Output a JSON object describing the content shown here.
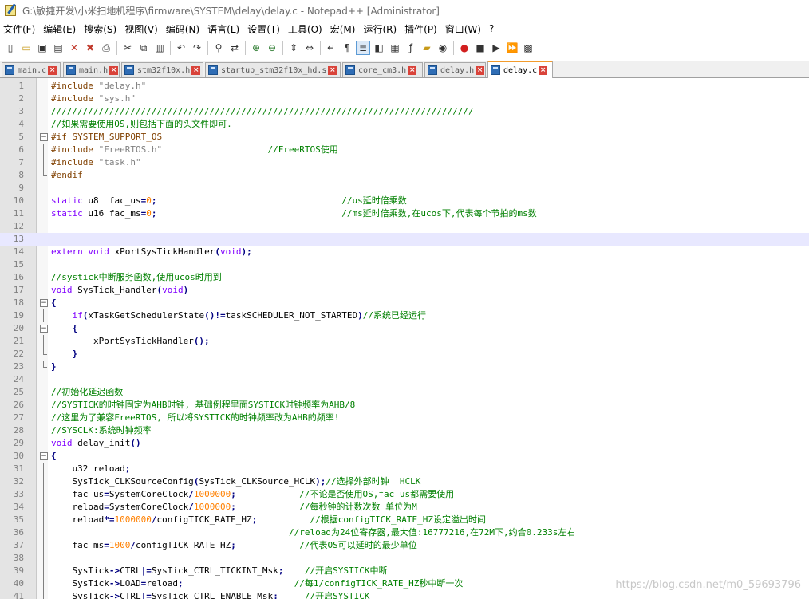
{
  "window": {
    "title": "G:\\敏捷开发\\小米扫地机程序\\firmware\\SYSTEM\\delay\\delay.c - Notepad++ [Administrator]"
  },
  "menu": [
    "文件(F)",
    "编辑(E)",
    "搜索(S)",
    "视图(V)",
    "编码(N)",
    "语言(L)",
    "设置(T)",
    "工具(O)",
    "宏(M)",
    "运行(R)",
    "插件(P)",
    "窗口(W)",
    "?"
  ],
  "toolbar_icons": [
    "new-file-icon",
    "open-file-icon",
    "save-icon",
    "save-all-icon",
    "close-icon",
    "close-all-icon",
    "print-icon",
    "cut-icon",
    "copy-icon",
    "paste-icon",
    "undo-icon",
    "redo-icon",
    "find-icon",
    "replace-icon",
    "zoom-in-icon",
    "zoom-out-icon",
    "sync-vertical-icon",
    "sync-horizontal-icon",
    "word-wrap-icon",
    "show-all-chars-icon",
    "indent-guide-icon",
    "user-lang-icon",
    "doc-map-icon",
    "function-list-icon",
    "folder-workspace-icon",
    "monitor-icon",
    "record-macro-icon",
    "stop-record-icon",
    "play-macro-icon",
    "run-macro-multiple-icon",
    "save-macro-icon"
  ],
  "tabs": [
    {
      "label": "main.c",
      "active": false
    },
    {
      "label": "main.h",
      "active": false
    },
    {
      "label": "stm32f10x.h",
      "active": false
    },
    {
      "label": "startup_stm32f10x_hd.s",
      "active": false
    },
    {
      "label": "core_cm3.h",
      "active": false
    },
    {
      "label": "delay.h",
      "active": false
    },
    {
      "label": "delay.c",
      "active": true
    }
  ],
  "editor": {
    "current_line": 13,
    "lines": [
      {
        "n": 1,
        "tokens": [
          [
            "pp",
            "#include "
          ],
          [
            "str",
            "\"delay.h\""
          ]
        ]
      },
      {
        "n": 2,
        "tokens": [
          [
            "pp",
            "#include "
          ],
          [
            "str",
            "\"sys.h\""
          ]
        ]
      },
      {
        "n": 3,
        "tokens": [
          [
            "cm",
            "////////////////////////////////////////////////////////////////////////////////"
          ]
        ]
      },
      {
        "n": 4,
        "tokens": [
          [
            "cm",
            "//如果需要使用OS,则包括下面的头文件即可."
          ]
        ]
      },
      {
        "n": 5,
        "fold": "open",
        "tokens": [
          [
            "pp",
            "#if SYSTEM_SUPPORT_OS"
          ]
        ]
      },
      {
        "n": 6,
        "fold": "bar",
        "tokens": [
          [
            "pp",
            "#include "
          ],
          [
            "str",
            "\"FreeRTOS.h\""
          ],
          [
            "id",
            "                    "
          ],
          [
            "cm",
            "//FreeRTOS使用"
          ]
        ]
      },
      {
        "n": 7,
        "fold": "bar",
        "tokens": [
          [
            "pp",
            "#include "
          ],
          [
            "str",
            "\"task.h\""
          ]
        ]
      },
      {
        "n": 8,
        "fold": "end",
        "tokens": [
          [
            "pp",
            "#endif"
          ]
        ]
      },
      {
        "n": 9,
        "tokens": []
      },
      {
        "n": 10,
        "tokens": [
          [
            "kw",
            "static"
          ],
          [
            "id",
            " u8  fac_us"
          ],
          [
            "op",
            "="
          ],
          [
            "num",
            "0"
          ],
          [
            "op",
            ";"
          ],
          [
            "id",
            "                                   "
          ],
          [
            "cm",
            "//us延时倍乘数"
          ]
        ]
      },
      {
        "n": 11,
        "tokens": [
          [
            "kw",
            "static"
          ],
          [
            "id",
            " u16 fac_ms"
          ],
          [
            "op",
            "="
          ],
          [
            "num",
            "0"
          ],
          [
            "op",
            ";"
          ],
          [
            "id",
            "                                   "
          ],
          [
            "cm",
            "//ms延时倍乘数,在ucos下,代表每个节拍的ms数"
          ]
        ]
      },
      {
        "n": 12,
        "tokens": []
      },
      {
        "n": 13,
        "tokens": []
      },
      {
        "n": 14,
        "tokens": [
          [
            "kw",
            "extern"
          ],
          [
            "id",
            " "
          ],
          [
            "kw",
            "void"
          ],
          [
            "id",
            " xPortSysTickHandler"
          ],
          [
            "op",
            "("
          ],
          [
            "kw",
            "void"
          ],
          [
            "op",
            ");"
          ]
        ]
      },
      {
        "n": 15,
        "tokens": []
      },
      {
        "n": 16,
        "tokens": [
          [
            "cm",
            "//systick中断服务函数,使用ucos时用到"
          ]
        ]
      },
      {
        "n": 17,
        "tokens": [
          [
            "kw",
            "void"
          ],
          [
            "id",
            " SysTick_Handler"
          ],
          [
            "op",
            "("
          ],
          [
            "kw",
            "void"
          ],
          [
            "op",
            ")"
          ]
        ]
      },
      {
        "n": 18,
        "fold": "open",
        "tokens": [
          [
            "op",
            "{"
          ]
        ]
      },
      {
        "n": 19,
        "fold": "bar",
        "tokens": [
          [
            "id",
            "    "
          ],
          [
            "kw",
            "if"
          ],
          [
            "op",
            "("
          ],
          [
            "id",
            "xTaskGetSchedulerState"
          ],
          [
            "op",
            "()!="
          ],
          [
            "id",
            "taskSCHEDULER_NOT_STARTED"
          ],
          [
            "op",
            ")"
          ],
          [
            "cm",
            "//系统已经运行"
          ]
        ]
      },
      {
        "n": 20,
        "fold": "open",
        "tokens": [
          [
            "id",
            "    "
          ],
          [
            "op",
            "{"
          ]
        ]
      },
      {
        "n": 21,
        "fold": "bar",
        "tokens": [
          [
            "id",
            "        xPortSysTickHandler"
          ],
          [
            "op",
            "();"
          ]
        ]
      },
      {
        "n": 22,
        "fold": "end",
        "tokens": [
          [
            "id",
            "    "
          ],
          [
            "op",
            "}"
          ]
        ]
      },
      {
        "n": 23,
        "fold": "end",
        "tokens": [
          [
            "op",
            "}"
          ]
        ]
      },
      {
        "n": 24,
        "tokens": []
      },
      {
        "n": 25,
        "tokens": [
          [
            "cm",
            "//初始化延迟函数"
          ]
        ]
      },
      {
        "n": 26,
        "tokens": [
          [
            "cm",
            "//SYSTICK的时钟固定为AHB时钟, 基础例程里面SYSTICK时钟频率为AHB/8"
          ]
        ]
      },
      {
        "n": 27,
        "tokens": [
          [
            "cm",
            "//这里为了兼容FreeRTOS, 所以将SYSTICK的时钟频率改为AHB的频率!"
          ]
        ]
      },
      {
        "n": 28,
        "tokens": [
          [
            "cm",
            "//SYSCLK:系统时钟频率"
          ]
        ]
      },
      {
        "n": 29,
        "tokens": [
          [
            "kw",
            "void"
          ],
          [
            "id",
            " delay_init"
          ],
          [
            "op",
            "()"
          ]
        ]
      },
      {
        "n": 30,
        "fold": "open",
        "tokens": [
          [
            "op",
            "{"
          ]
        ]
      },
      {
        "n": 31,
        "fold": "bar",
        "tokens": [
          [
            "id",
            "    u32 reload"
          ],
          [
            "op",
            ";"
          ]
        ]
      },
      {
        "n": 32,
        "fold": "bar",
        "tokens": [
          [
            "id",
            "    SysTick_CLKSourceConfig"
          ],
          [
            "op",
            "("
          ],
          [
            "id",
            "SysTick_CLKSource_HCLK"
          ],
          [
            "op",
            ");"
          ],
          [
            "cm",
            "//选择外部时钟  HCLK"
          ]
        ]
      },
      {
        "n": 33,
        "fold": "bar",
        "tokens": [
          [
            "id",
            "    fac_us"
          ],
          [
            "op",
            "="
          ],
          [
            "id",
            "SystemCoreClock"
          ],
          [
            "op",
            "/"
          ],
          [
            "num",
            "1000000"
          ],
          [
            "op",
            ";"
          ],
          [
            "id",
            "            "
          ],
          [
            "cm",
            "//不论是否使用OS,fac_us都需要使用"
          ]
        ]
      },
      {
        "n": 34,
        "fold": "bar",
        "tokens": [
          [
            "id",
            "    reload"
          ],
          [
            "op",
            "="
          ],
          [
            "id",
            "SystemCoreClock"
          ],
          [
            "op",
            "/"
          ],
          [
            "num",
            "1000000"
          ],
          [
            "op",
            ";"
          ],
          [
            "id",
            "            "
          ],
          [
            "cm",
            "//每秒钟的计数次数 单位为M"
          ]
        ]
      },
      {
        "n": 35,
        "fold": "bar",
        "tokens": [
          [
            "id",
            "    reload"
          ],
          [
            "op",
            "*="
          ],
          [
            "num",
            "1000000"
          ],
          [
            "op",
            "/"
          ],
          [
            "id",
            "configTICK_RATE_HZ"
          ],
          [
            "op",
            ";"
          ],
          [
            "id",
            "          "
          ],
          [
            "cm",
            "//根据configTICK_RATE_HZ设定溢出时间"
          ]
        ]
      },
      {
        "n": 36,
        "fold": "bar",
        "tokens": [
          [
            "id",
            "                                             "
          ],
          [
            "cm",
            "//reload为24位寄存器,最大值:16777216,在72M下,约合0.233s左右"
          ]
        ]
      },
      {
        "n": 37,
        "fold": "bar",
        "tokens": [
          [
            "id",
            "    fac_ms"
          ],
          [
            "op",
            "="
          ],
          [
            "num",
            "1000"
          ],
          [
            "op",
            "/"
          ],
          [
            "id",
            "configTICK_RATE_HZ"
          ],
          [
            "op",
            ";"
          ],
          [
            "id",
            "            "
          ],
          [
            "cm",
            "//代表OS可以延时的最少单位"
          ]
        ]
      },
      {
        "n": 38,
        "fold": "bar",
        "tokens": []
      },
      {
        "n": 39,
        "fold": "bar",
        "tokens": [
          [
            "id",
            "    SysTick"
          ],
          [
            "op",
            "->"
          ],
          [
            "id",
            "CTRL"
          ],
          [
            "op",
            "|="
          ],
          [
            "id",
            "SysTick_CTRL_TICKINT_Msk"
          ],
          [
            "op",
            ";"
          ],
          [
            "id",
            "    "
          ],
          [
            "cm",
            "//开启SYSTICK中断"
          ]
        ]
      },
      {
        "n": 40,
        "fold": "bar",
        "tokens": [
          [
            "id",
            "    SysTick"
          ],
          [
            "op",
            "->"
          ],
          [
            "id",
            "LOAD"
          ],
          [
            "op",
            "="
          ],
          [
            "id",
            "reload"
          ],
          [
            "op",
            ";"
          ],
          [
            "id",
            "                     "
          ],
          [
            "cm",
            "//每1/configTICK_RATE_HZ秒中断一次"
          ]
        ]
      },
      {
        "n": 41,
        "fold": "bar",
        "tokens": [
          [
            "id",
            "    SysTick"
          ],
          [
            "op",
            "->"
          ],
          [
            "id",
            "CTRL"
          ],
          [
            "op",
            "|="
          ],
          [
            "id",
            "SysTick_CTRL_ENABLE_Msk"
          ],
          [
            "op",
            ";"
          ],
          [
            "id",
            "     "
          ],
          [
            "cm",
            "//开启SYSTICK"
          ]
        ]
      }
    ]
  },
  "watermark": "https://blog.csdn.net/m0_59693796"
}
